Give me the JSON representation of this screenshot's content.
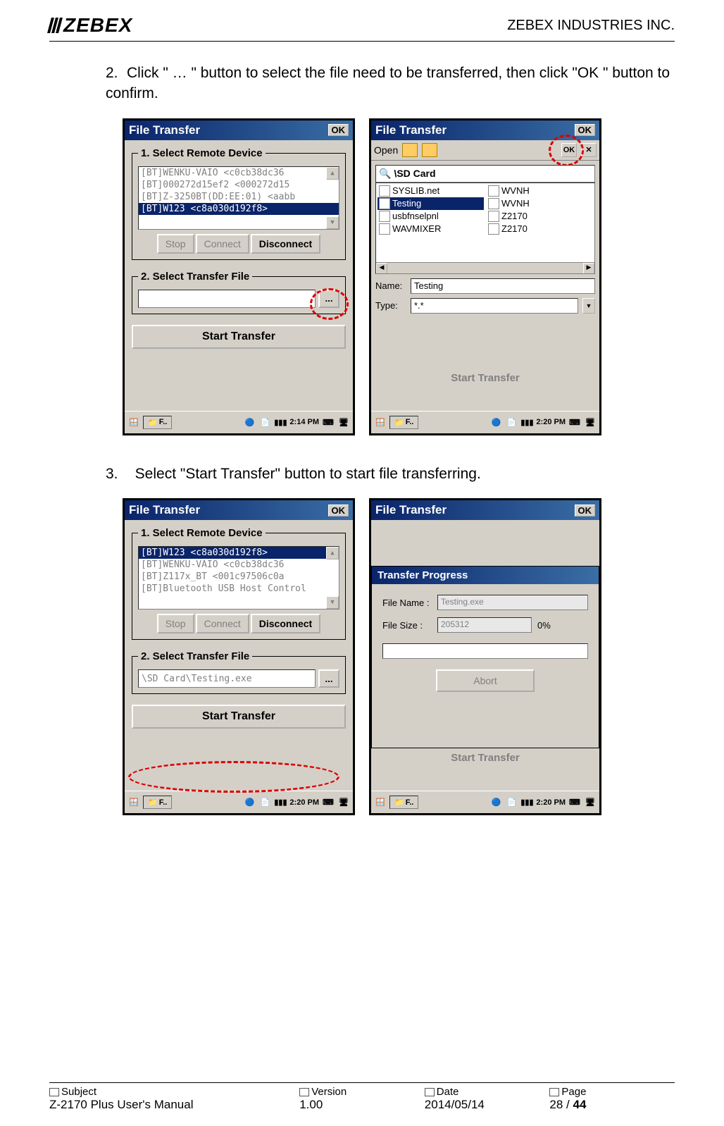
{
  "header": {
    "logo_text": "ZEBEX",
    "company": "ZEBEX INDUSTRIES INC."
  },
  "step2": {
    "number": "2.",
    "text": "Click \" … \" button to select the file need to be transferred, then click \"OK \" button to confirm."
  },
  "step3": {
    "number": "3.",
    "text": "Select \"Start Transfer\" button to start file transferring."
  },
  "screen_a": {
    "title": "File Transfer",
    "ok": "OK",
    "fs1_legend": "1. Select Remote Device",
    "devices": [
      "[BT]WENKU-VAIO <c0cb38dc36",
      "[BT]000272d15ef2 <000272d15",
      "[BT]Z-3250BT(DD:EE:01) <aabb",
      "[BT]W123 <c8a030d192f8>"
    ],
    "selected_device_idx": 3,
    "btn_stop": "Stop",
    "btn_connect": "Connect",
    "btn_disconnect": "Disconnect",
    "fs2_legend": "2. Select Transfer File",
    "file_path": "",
    "browse": "...",
    "start_transfer": "Start Transfer",
    "taskbar_app": "F..",
    "taskbar_time": "2:14 PM"
  },
  "screen_b": {
    "title": "File Transfer",
    "ok": "OK",
    "open_label": "Open",
    "toolbar_ok": "OK",
    "toolbar_x": "✕",
    "path": "\\SD Card",
    "files_col1": [
      "SYSLIB.net",
      "Testing",
      "usbfnselpnl",
      "WAVMIXER"
    ],
    "files_col2": [
      "WVNH",
      "WVNH",
      "Z2170",
      "Z2170"
    ],
    "selected_file_idx": 1,
    "name_label": "Name:",
    "name_value": "Testing",
    "type_label": "Type:",
    "type_value": "*.*",
    "bg_start_transfer": "Start Transfer",
    "taskbar_app": "F..",
    "taskbar_time": "2:20 PM"
  },
  "screen_c": {
    "title": "File Transfer",
    "ok": "OK",
    "fs1_legend": "1. Select Remote Device",
    "devices": [
      "[BT]W123 <c8a030d192f8>",
      "[BT]WENKU-VAIO <c0cb38dc36",
      "[BT]Z117x_BT <001c97506c0a",
      "[BT]Bluetooth USB Host Control"
    ],
    "selected_device_idx": 0,
    "btn_stop": "Stop",
    "btn_connect": "Connect",
    "btn_disconnect": "Disconnect",
    "fs2_legend": "2. Select Transfer File",
    "file_path": "\\SD Card\\Testing.exe",
    "browse": "...",
    "start_transfer": "Start Transfer",
    "taskbar_app": "F..",
    "taskbar_time": "2:20 PM"
  },
  "screen_d": {
    "title": "File Transfer",
    "ok": "OK",
    "progress_title": "Transfer Progress",
    "file_name_label": "File Name :",
    "file_name_value": "Testing.exe",
    "file_size_label": "File Size    :",
    "file_size_value": "205312",
    "percent": "0%",
    "abort": "Abort",
    "bg_start_transfer": "Start Transfer",
    "taskbar_app": "F..",
    "taskbar_time": "2:20 PM"
  },
  "footer": {
    "subject_label": "Subject",
    "subject_value": "Z-2170 Plus User's Manual",
    "version_label": "Version",
    "version_value": "1.00",
    "date_label": "Date",
    "date_value": "2014/05/14",
    "page_label": "Page",
    "page_value_a": "28 / ",
    "page_value_b": "44"
  }
}
